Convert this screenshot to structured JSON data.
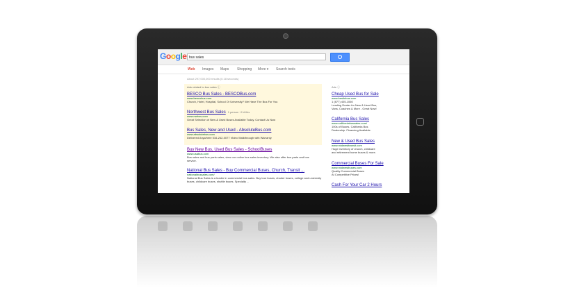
{
  "logo": {
    "g1": "G",
    "o1": "o",
    "o2": "o",
    "g2": "g",
    "l": "l",
    "e": "e"
  },
  "search": {
    "query": "bus sales"
  },
  "nav": [
    "Web",
    "Images",
    "Maps",
    "Shopping",
    "More ▾",
    "Search tools"
  ],
  "stats": "About 297,000,000 results (0.18 seconds)",
  "ads_heading": "Ads related to bus sales ⓘ",
  "results": [
    {
      "title": "BESCO Bus Sales - BESCOBus.com",
      "url": "www.bescobus.com",
      "snippet": "Church, Hotel, Hospital, School Or University? We Have The Bus For You",
      "extra": ""
    },
    {
      "title": "Northwest Bus Sales",
      "url": "www.nwbus.com",
      "snippet": "Great Selection of New & Used Buses Available Today. Contact Us Now",
      "extra": "1 person +1'd this"
    },
    {
      "title": "Bus Sales, New and Used - AbsoluteBus.com",
      "url": "www.absolutebus.com",
      "snippet": "Delivered Anywhere 516-242-0077 Video Walkthrough with Warranty",
      "extra": ""
    },
    {
      "title": "Buy New Bus, Used Bus Sales - SchoolBuses",
      "url": "www.usabus.com",
      "snippet": "Bus sales and bus parts sales, view our online bus sales inventory. We also offer bus parts and bus service.",
      "extra": ""
    },
    {
      "title": "National Bus Sales - Buy Commercial Buses, Church, Transit ...",
      "url": "nationalbussales.com/",
      "snippet": "National Bus Sales is a leader in commercial bus sales. Buy tour buses, charter buses, college and university buses, childcare buses, shuttle buses. Specialty ...",
      "extra": ""
    }
  ],
  "side_label": "Ads ⓘ",
  "side_ads": [
    {
      "title": "Cheap Used Bus for Sale",
      "url": "www.bestinbus.com",
      "lines": [
        "1 (877) 405-1060",
        "Leading Dealer for New & Used Bus,",
        "Vans, Coaches & More - Great Now!"
      ]
    },
    {
      "title": "California Bus Sales",
      "url": "www.californiabussales.com/",
      "lines": [
        "100s of Buses. California Bus",
        "Dealership. Financing Available."
      ]
    },
    {
      "title": "New & Used Bus Sales",
      "url": "www.midwesttransit.com",
      "lines": [
        "Huge inventory of church, childcare",
        "and retirement home buses & more."
      ]
    },
    {
      "title": "Commercial Buses For Sale",
      "url": "www.midwestbuses.com",
      "lines": [
        "Quality Commercial Buses",
        "At Competitive Prices!"
      ]
    },
    {
      "title": "Cash For Your Car 2 Hours",
      "url": "",
      "lines": []
    }
  ]
}
